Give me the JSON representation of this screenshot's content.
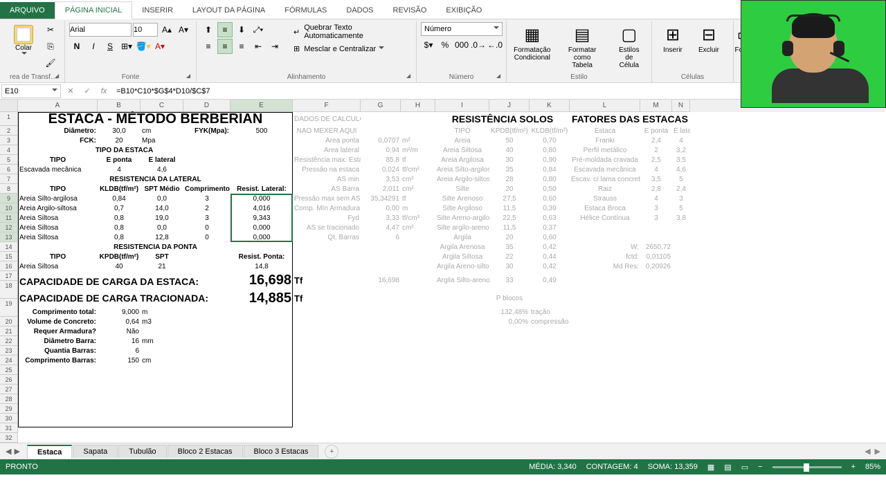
{
  "ribbon": {
    "tabs": [
      "ARQUIVO",
      "PÁGINA INICIAL",
      "INSERIR",
      "LAYOUT DA PÁGINA",
      "FÓRMULAS",
      "DADOS",
      "REVISÃO",
      "EXIBIÇÃO"
    ],
    "groups": {
      "clipboard": {
        "label": "rea de Transf…",
        "paste": "Colar"
      },
      "font": {
        "label": "Fonte",
        "name": "Arial",
        "size": "10"
      },
      "align": {
        "label": "Alinhamento",
        "wrap": "Quebrar Texto Automaticamente",
        "merge": "Mesclar e Centralizar"
      },
      "number": {
        "label": "Número",
        "format": "Número"
      },
      "styles": {
        "label": "Estilo",
        "condfmt": "Formatação\nCondicional",
        "table": "Formatar como\nTabela",
        "cellstyle": "Estilos de\nCélula"
      },
      "cells": {
        "label": "Células",
        "insert": "Inserir",
        "delete": "Excluir",
        "format": "Forma"
      }
    }
  },
  "formula_bar": {
    "cell_ref": "E10",
    "formula": "=B10*C10*$G$4*D10/$C$7"
  },
  "columns": [
    "A",
    "B",
    "C",
    "D",
    "E",
    "F",
    "G",
    "H",
    "I",
    "J",
    "K",
    "L",
    "M",
    "N"
  ],
  "sheet": {
    "title": "ESTACA - MÉTODO BERBERIAN",
    "params": {
      "diametro_label": "Diâmetro:",
      "diametro_val": "30,0",
      "diametro_unit": "cm",
      "fyk_label": "FYK(Mpa):",
      "fyk_val": "500",
      "fck_label": "FCK:",
      "fck_val": "20",
      "fck_unit": "Mpa"
    },
    "tipo_header": "TIPO DA ESTACA",
    "tipo_cols": {
      "c1": "TIPO",
      "c2": "E ponta",
      "c3": "E lateral"
    },
    "tipo_row": {
      "name": "Escavada mecânica",
      "eponta": "4",
      "elat": "4,6"
    },
    "res_lat_header": "RESISTÊNCIA DA LATERAL",
    "res_lat_cols": {
      "c1": "TIPO",
      "c2": "KLDB(tf/m²)",
      "c3": "SPT Médio",
      "c4": "Comprimento",
      "c5": "Resist. Lateral:"
    },
    "res_lat_rows": [
      {
        "tipo": "Areia Silto-argilosa",
        "kldb": "0,84",
        "spt": "0,0",
        "comp": "3",
        "res": "0,000"
      },
      {
        "tipo": "Areia Argilo-siltosa",
        "kldb": "0,7",
        "spt": "14,0",
        "comp": "2",
        "res": "4,016"
      },
      {
        "tipo": "Areia Siltosa",
        "kldb": "0,8",
        "spt": "19,0",
        "comp": "3",
        "res": "9,343"
      },
      {
        "tipo": "Areia Siltosa",
        "kldb": "0,8",
        "spt": "0,0",
        "comp": "0",
        "res": "0,000"
      },
      {
        "tipo": "Areia Siltosa",
        "kldb": "0,8",
        "spt": "12,8",
        "comp": "0",
        "res": "0,000"
      }
    ],
    "res_ponta_header": "RESISTÊNCIA DA PONTA",
    "res_ponta_cols": {
      "c1": "TIPO",
      "c2": "KPDB(tf/m²)",
      "c3": "SPT",
      "c5": "Resist. Ponta:"
    },
    "res_ponta_row": {
      "tipo": "Areia Siltosa",
      "kpdb": "40",
      "spt": "21",
      "res": "14,8"
    },
    "cap1_label": "CAPACIDADE DE CARGA DA ESTACA:",
    "cap1_val": "16,698",
    "cap1_unit": "Tf",
    "cap2_label": "CAPACIDADE DE CARGA TRACIONADA:",
    "cap2_val": "14,885",
    "cap2_unit": "Tf",
    "extras": [
      {
        "label": "Comprimento total:",
        "val": "9,000",
        "unit": "m"
      },
      {
        "label": "Volume de Concreto:",
        "val": "0,64",
        "unit": "m3"
      },
      {
        "label": "Requer Armadura?",
        "val": "Não",
        "unit": ""
      },
      {
        "label": "Diâmetro Barra:",
        "val": "16",
        "unit": "mm"
      },
      {
        "label": "Quantia Barras:",
        "val": "6",
        "unit": ""
      },
      {
        "label": "Comprimento Barras:",
        "val": "150",
        "unit": "cm"
      }
    ],
    "calc_header1": "DADOS DE CÁLCULO",
    "calc_header2": "NÃO MEXER AQUI",
    "calc_rows": [
      {
        "l": "Área ponta",
        "v": "0,0707",
        "u": "m²"
      },
      {
        "l": "Área lateral",
        "v": "0,94",
        "u": "m²/m"
      },
      {
        "l": "Resistência max. Estaca",
        "v": "85,8",
        "u": "tf"
      },
      {
        "l": "Pressão na estaca",
        "v": "0,024",
        "u": "tf/cm²"
      },
      {
        "l": "AS min",
        "v": "3,53",
        "u": "cm²"
      },
      {
        "l": "AS Barra",
        "v": "2,011",
        "u": "cm²"
      },
      {
        "l": "Pressão max sem AS",
        "v": "35,34291",
        "u": "tf"
      },
      {
        "l": "Comp. Mín Armadura",
        "v": "0,00",
        "u": "m"
      },
      {
        "l": "Fyd",
        "v": "3,33",
        "u": "tf/cm²"
      },
      {
        "l": "AS se tracionado",
        "v": "4,47",
        "u": "cm²"
      },
      {
        "l": "Qt. Barras",
        "v": "6",
        "u": ""
      }
    ],
    "calc_sum": "16,698",
    "soils_header": "RESISTÊNCIA SOLOS",
    "soils_cols": {
      "c1": "TIPO",
      "c2": "KPDB(tf/m²)",
      "c3": "KLDB(tf/m²)"
    },
    "soils": [
      {
        "t": "Areia",
        "p": "50",
        "l": "0,70"
      },
      {
        "t": "Areia Siltosa",
        "p": "40",
        "l": "0,80"
      },
      {
        "t": "Areia Argilosa",
        "p": "30",
        "l": "0,90"
      },
      {
        "t": "Areia Silto-argilosa",
        "p": "35",
        "l": "0,84"
      },
      {
        "t": "Areia Argilo-siltosa",
        "p": "28",
        "l": "0,80"
      },
      {
        "t": "Silte",
        "p": "20",
        "l": "0,50"
      },
      {
        "t": "Silte Arenoso",
        "p": "27,5",
        "l": "0,60"
      },
      {
        "t": "Silte Argiloso",
        "p": "11,5",
        "l": "0,39"
      },
      {
        "t": "Silte Areno-argiloso",
        "p": "22,5",
        "l": "0,63"
      },
      {
        "t": "Silte argilo-arenoso",
        "p": "11,5",
        "l": "0,37"
      },
      {
        "t": "Argila",
        "p": "20",
        "l": "0,60"
      },
      {
        "t": "Argila Arenosa",
        "p": "35",
        "l": "0,42"
      },
      {
        "t": "Argila Siltosa",
        "p": "22",
        "l": "0,44"
      },
      {
        "t": "Argila Areno-siltosa",
        "p": "30",
        "l": "0,42"
      },
      {
        "t": "Argila Silto-arenosa",
        "p": "33",
        "l": "0,49"
      }
    ],
    "fatores_header": "FATORES DAS ESTACAS",
    "fatores_cols": {
      "c1": "Estaca",
      "c2": "E ponta",
      "c3": "E lateral"
    },
    "fatores": [
      {
        "e": "Franki",
        "p": "2,4",
        "l": "4"
      },
      {
        "e": "Perfil metálico",
        "p": "2",
        "l": "3,2"
      },
      {
        "e": "Pré-moldada cravada",
        "p": "2,5",
        "l": "3,5"
      },
      {
        "e": "Escavada mecânica",
        "p": "4",
        "l": "4,6"
      },
      {
        "e": "Escav. c/ lama concreto",
        "p": "3,5",
        "l": "5"
      },
      {
        "e": "Raiz",
        "p": "2,8",
        "l": "2,4"
      },
      {
        "e": "Strauss",
        "p": "4",
        "l": "3"
      },
      {
        "e": "Estaca Broca",
        "p": "3",
        "l": "5"
      },
      {
        "e": "Hélice Contínua",
        "p": "3",
        "l": "3,8"
      }
    ],
    "consts": [
      {
        "l": "W:",
        "v": "2650,72"
      },
      {
        "l": "fctd:",
        "v": "0,01105"
      },
      {
        "l": "Md Res:",
        "v": "0,20926"
      }
    ],
    "blocos": {
      "h": "P blocos",
      "r1a": "132,48%",
      "r1b": "tração",
      "r2a": "0,00%",
      "r2b": "compressão"
    }
  },
  "sheet_tabs": [
    "Estaca",
    "Sapata",
    "Tubulão",
    "Bloco 2 Estacas",
    "Bloco 3 Estacas"
  ],
  "status": {
    "ready": "PRONTO",
    "avg": "MÉDIA: 3,340",
    "count": "CONTAGEM: 4",
    "sum": "SOMA: 13,359",
    "zoom": "85%"
  }
}
